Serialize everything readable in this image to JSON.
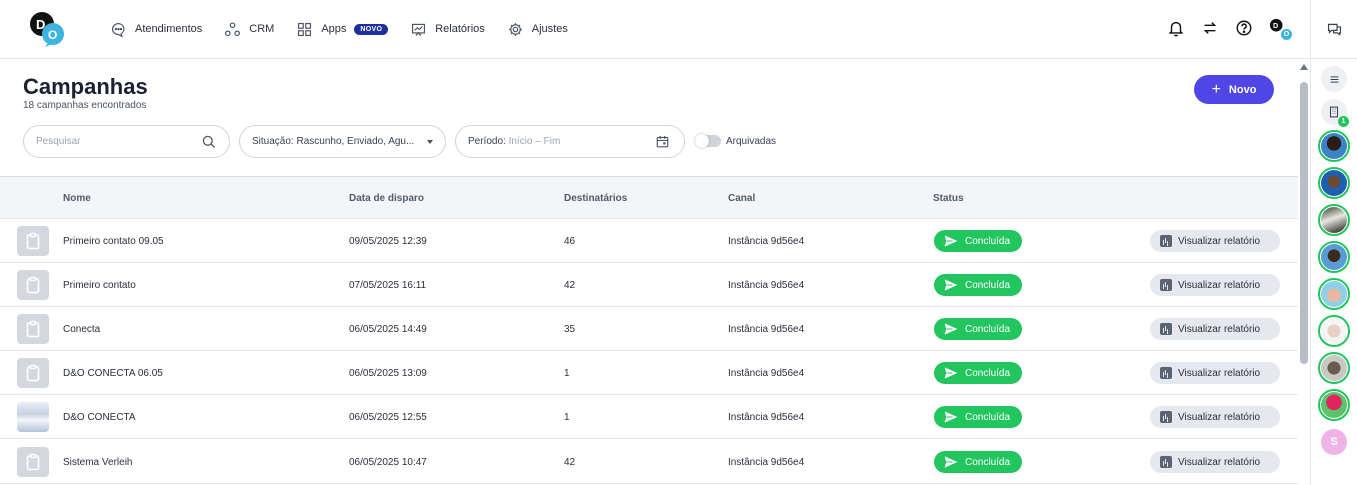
{
  "nav": {
    "items": [
      {
        "label": "Atendimentos",
        "icon": "chat-bubble-icon"
      },
      {
        "label": "CRM",
        "icon": "crm-nodes-icon"
      },
      {
        "label": "Apps",
        "icon": "grid-icon",
        "badge": "NOVO"
      },
      {
        "label": "Relatórios",
        "icon": "report-chart-icon"
      },
      {
        "label": "Ajustes",
        "icon": "gear-icon"
      }
    ],
    "user_badge": "O"
  },
  "page": {
    "title": "Campanhas",
    "subtitle": "18 campanhas encontrados",
    "new_button": "Novo"
  },
  "filters": {
    "search_placeholder": "Pesquisar",
    "situation": "Situação: Rascunho, Enviado, Agu...",
    "period_label": "Período:",
    "period_value": "Início – Fim",
    "archived_label": "Arquivadas",
    "archived_on": false
  },
  "table": {
    "headers": [
      "Nome",
      "Data de disparo",
      "Destinatários",
      "Canal",
      "Status"
    ],
    "rows": [
      {
        "name": "Primeiro contato 09.05",
        "date": "09/05/2025 12:39",
        "recipients": "46",
        "channel": "Instância 9d56e4",
        "status": "Concluída",
        "action": "Visualizar relatório"
      },
      {
        "name": "Primeiro contato",
        "date": "07/05/2025 16:11",
        "recipients": "42",
        "channel": "Instância 9d56e4",
        "status": "Concluída",
        "action": "Visualizar relatório"
      },
      {
        "name": "Conecta",
        "date": "06/05/2025 14:49",
        "recipients": "35",
        "channel": "Instância 9d56e4",
        "status": "Concluída",
        "action": "Visualizar relatório"
      },
      {
        "name": "D&O CONECTA 06.05",
        "date": "06/05/2025 13:09",
        "recipients": "1",
        "channel": "Instância 9d56e4",
        "status": "Concluída",
        "action": "Visualizar relatório"
      },
      {
        "name": "D&O CONECTA",
        "date": "06/05/2025 12:55",
        "recipients": "1",
        "channel": "Instância 9d56e4",
        "status": "Concluída",
        "action": "Visualizar relatório"
      },
      {
        "name": "Sistema Verleih",
        "date": "06/05/2025 10:47",
        "recipients": "42",
        "channel": "Instância 9d56e4",
        "status": "Concluída",
        "action": "Visualizar relatório"
      }
    ]
  },
  "rail": {
    "building_count": "1",
    "last_avatar_initial": "S"
  },
  "colors": {
    "primary": "#4f46e5",
    "success": "#22c55e",
    "nav_badge": "#1e2fa0"
  }
}
